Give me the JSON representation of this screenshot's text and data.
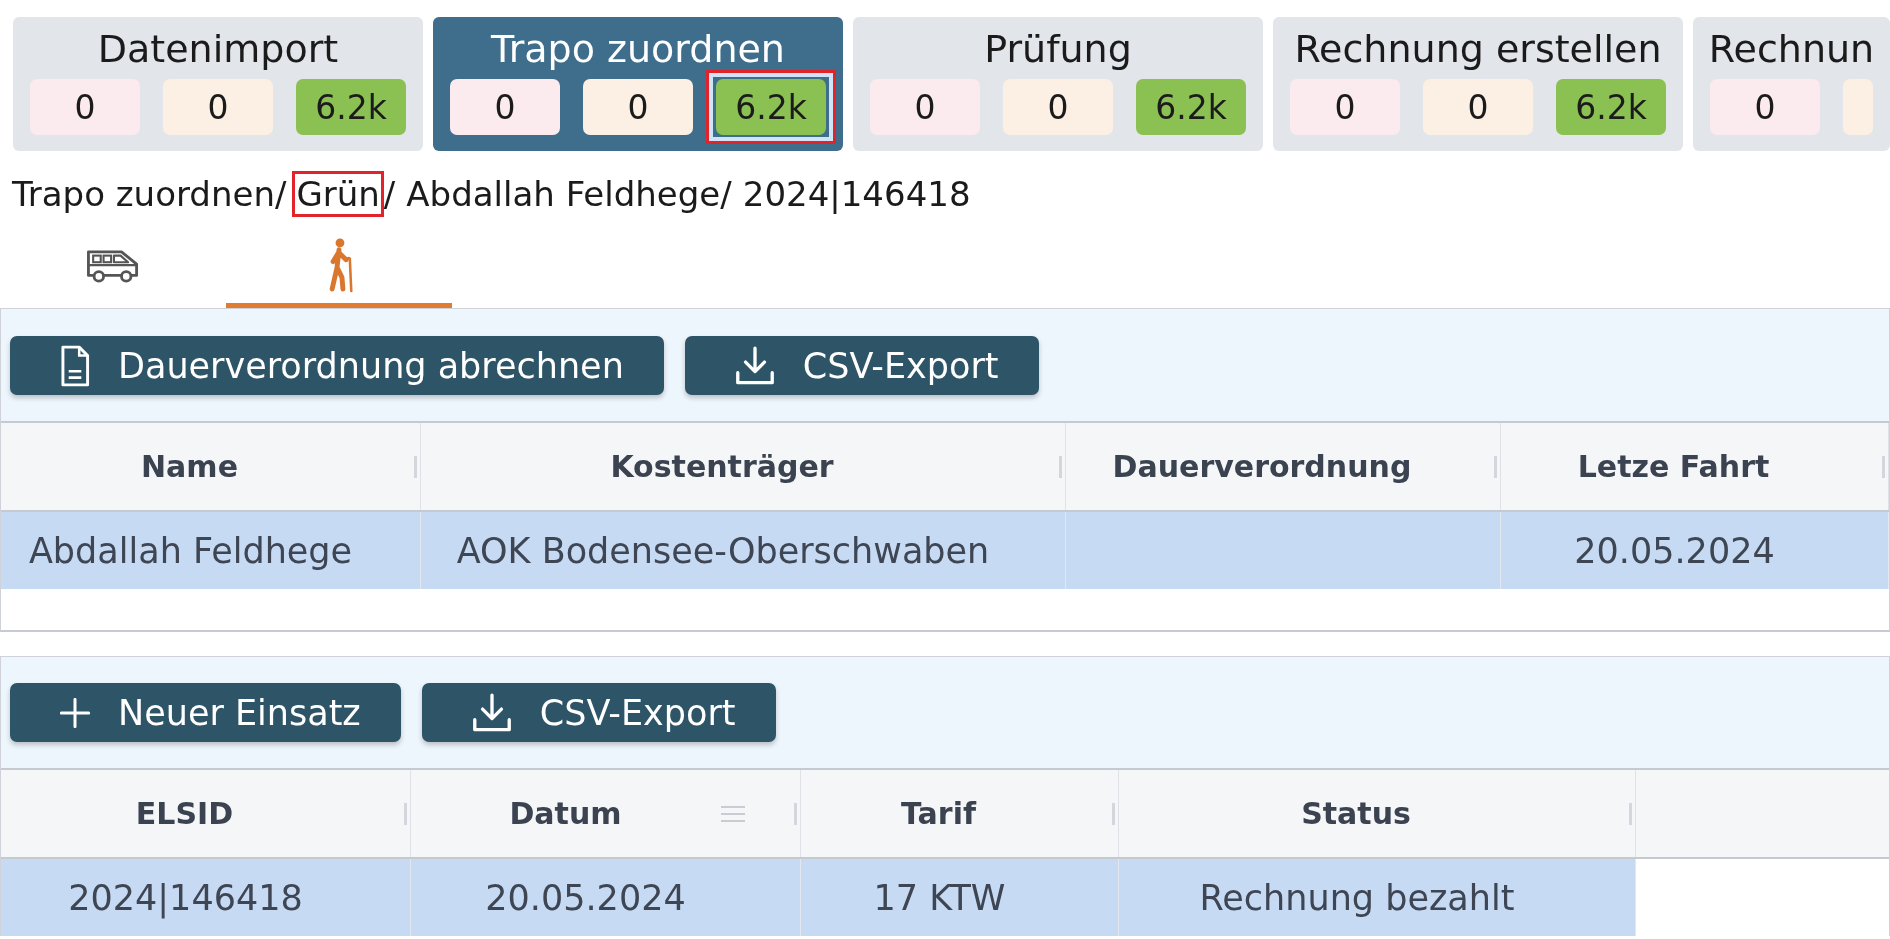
{
  "stages": [
    {
      "title": "Datenimport",
      "selected": false,
      "counts": [
        {
          "value": "0",
          "color": "#fbeaee",
          "marked": false
        },
        {
          "value": "0",
          "color": "#fbf0e3",
          "marked": false
        },
        {
          "value": "6.2k",
          "color": "#8bc152",
          "marked": false
        }
      ]
    },
    {
      "title": "Trapo zuordnen",
      "selected": true,
      "counts": [
        {
          "value": "0",
          "color": "#fbeaee",
          "marked": false
        },
        {
          "value": "0",
          "color": "#fbf0e3",
          "marked": false
        },
        {
          "value": "6.2k",
          "color": "#8bc152",
          "marked": true
        }
      ]
    },
    {
      "title": "Prüfung",
      "selected": false,
      "counts": [
        {
          "value": "0",
          "color": "#fbeaee",
          "marked": false
        },
        {
          "value": "0",
          "color": "#fbf0e3",
          "marked": false
        },
        {
          "value": "6.2k",
          "color": "#8bc152",
          "marked": false
        }
      ]
    },
    {
      "title": "Rechnung erstellen",
      "selected": false,
      "counts": [
        {
          "value": "0",
          "color": "#fbeaee",
          "marked": false
        },
        {
          "value": "0",
          "color": "#fbf0e3",
          "marked": false
        },
        {
          "value": "6.2k",
          "color": "#8bc152",
          "marked": false
        }
      ]
    },
    {
      "title": "Rechnun",
      "selected": false,
      "counts": [
        {
          "value": "0",
          "color": "#fbeaee",
          "marked": false
        },
        {
          "color": "#fbf0e3",
          "marked": false
        }
      ]
    }
  ],
  "breadcrumb": {
    "separator": "/",
    "items": [
      {
        "label": "Trapo zuordnen",
        "marked": false
      },
      {
        "label": "Grün",
        "marked": true
      },
      {
        "label": "Abdallah Feldhege",
        "marked": false
      },
      {
        "label": "2024|146418",
        "marked": false
      }
    ]
  },
  "tabs": [
    {
      "kind": "van",
      "selected": false
    },
    {
      "kind": "walker",
      "selected": true
    }
  ],
  "patient_panel": {
    "buttons": [
      {
        "kind": "document",
        "label": "Dauerverordnung abrechnen"
      },
      {
        "kind": "download",
        "label": "CSV-Export"
      }
    ],
    "table": {
      "columns": [
        {
          "label": "Name"
        },
        {
          "label": "Kostenträger"
        },
        {
          "label": "Dauerverordnung"
        },
        {
          "label": "Letze Fahrt"
        }
      ],
      "rows": [
        {
          "selected": true,
          "cells": [
            "Abdallah Feldhege",
            "AOK Bodensee-Oberschwaben",
            null,
            "20.05.2024"
          ]
        }
      ]
    }
  },
  "trip_panel": {
    "buttons": [
      {
        "kind": "add",
        "label": "Neuer Einsatz"
      },
      {
        "kind": "download",
        "label": "CSV-Export"
      }
    ],
    "table": {
      "columns": [
        {
          "label": "ELSID",
          "menu": false
        },
        {
          "label": "Datum",
          "menu": true
        },
        {
          "label": "Tarif",
          "menu": false
        },
        {
          "label": "Status",
          "menu": false
        }
      ],
      "rows": [
        {
          "selected": true,
          "cells": [
            "2024|146418",
            "20.05.2024",
            "17 KTW",
            "Rechnung bezahlt"
          ]
        }
      ]
    }
  }
}
